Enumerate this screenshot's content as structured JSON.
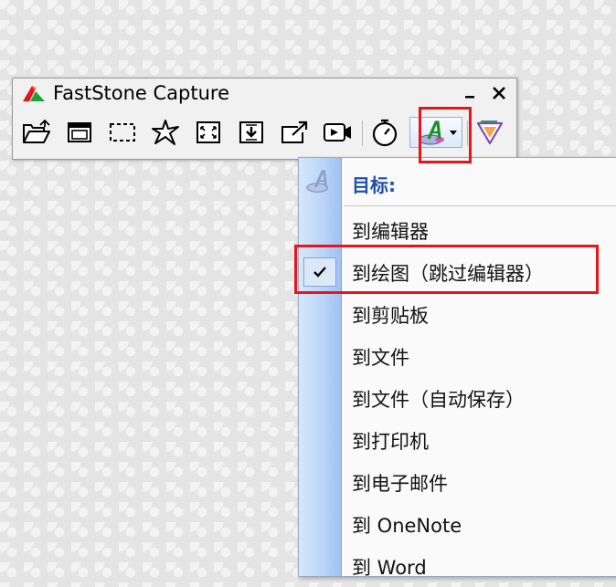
{
  "window": {
    "title": "FastStone Capture"
  },
  "toolbar": {
    "buttons": [
      {
        "name": "open-folder-icon"
      },
      {
        "name": "capture-window-icon"
      },
      {
        "name": "capture-rectangle-icon"
      },
      {
        "name": "capture-freehand-icon"
      },
      {
        "name": "capture-fullscreen-icon"
      },
      {
        "name": "capture-scrolling-icon"
      },
      {
        "name": "capture-fixed-region-icon"
      },
      {
        "name": "screen-recorder-icon"
      },
      {
        "name": "delay-timer-icon"
      },
      {
        "name": "output-destination-icon"
      },
      {
        "name": "settings-menu-icon"
      }
    ]
  },
  "menu": {
    "header": "目标:",
    "items": [
      {
        "label": "到编辑器",
        "checked": false
      },
      {
        "label": "到绘图（跳过编辑器）",
        "checked": true
      },
      {
        "label": "到剪贴板",
        "checked": false
      },
      {
        "label": "到文件",
        "checked": false
      },
      {
        "label": "到文件（自动保存）",
        "checked": false
      },
      {
        "label": "到打印机",
        "checked": false
      },
      {
        "label": "到电子邮件",
        "checked": false
      },
      {
        "label": "到 OneNote",
        "checked": false
      },
      {
        "label": "到 Word",
        "checked": false
      }
    ]
  },
  "colors": {
    "highlight": "#e8141b",
    "menu_header": "#1f4fa8",
    "gutter": "#b9d4f6"
  }
}
